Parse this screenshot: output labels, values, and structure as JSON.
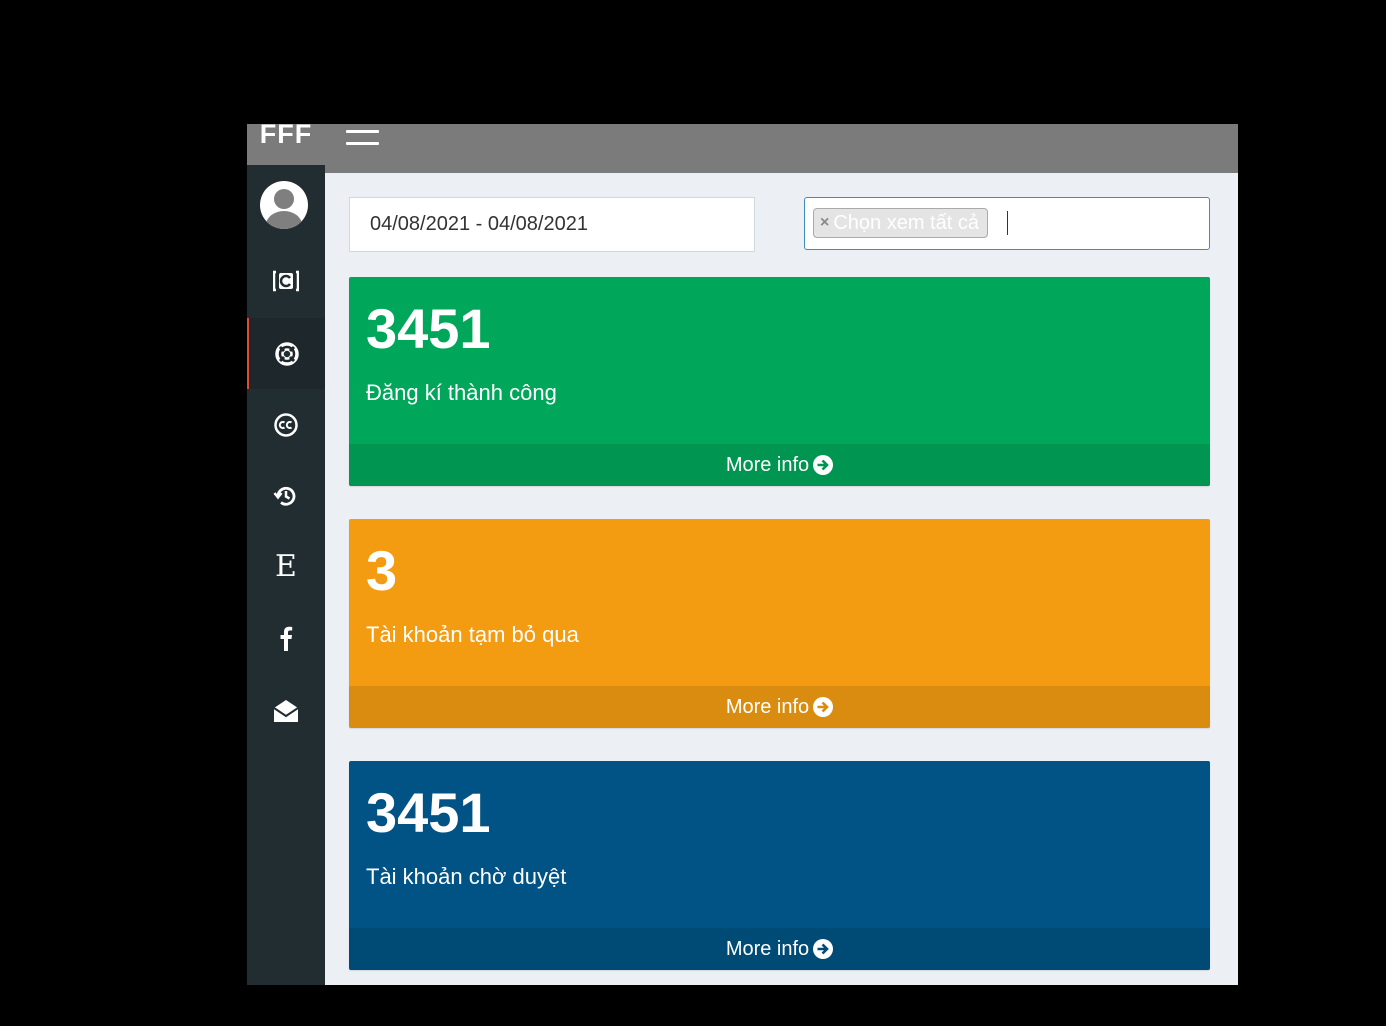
{
  "header": {
    "logo": "FFF"
  },
  "sidebar": {
    "items": [
      {
        "icon": "calendar-c-icon"
      },
      {
        "icon": "lifebuoy-icon"
      },
      {
        "icon": "creative-commons-icon"
      },
      {
        "icon": "history-icon"
      },
      {
        "icon": "letter-e-icon",
        "text": "E"
      },
      {
        "icon": "facebook-icon"
      },
      {
        "icon": "envelope-open-icon"
      }
    ],
    "active_index": 1
  },
  "filters": {
    "date_range": "04/08/2021 - 04/08/2021",
    "select_tag": "Chọn xem tất cả",
    "tag_remove": "×"
  },
  "boxes": [
    {
      "value": "3451",
      "label": "Đăng kí thành công",
      "footer": "More info",
      "color": "#00a65a"
    },
    {
      "value": "3",
      "label": "Tài khoản tạm bỏ qua",
      "footer": "More info",
      "color": "#f39c12"
    },
    {
      "value": "3451",
      "label": "Tài khoản chờ duyệt",
      "footer": "More info",
      "color": "#005384"
    }
  ]
}
